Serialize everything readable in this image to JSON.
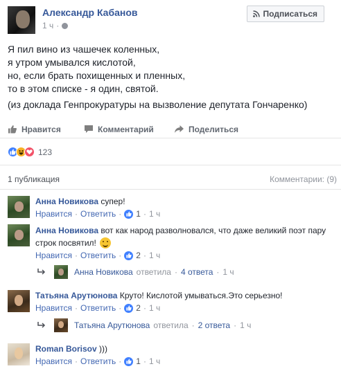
{
  "post": {
    "author": "Александр Кабанов",
    "time": "1 ч",
    "subscribe_label": "Подписаться",
    "lines": [
      "Я пил вино из чашечек коленных,",
      "я утром умывался кислотой,",
      "но, если брать похищенных и пленных,",
      "то в этом списке - я один, святой."
    ],
    "note": "(из доклада Генпрокуратуры на вызволение депутата Гончаренко)"
  },
  "actions": {
    "like": "Нравится",
    "comment": "Комментарий",
    "share": "Поделиться"
  },
  "reactions": {
    "count": "123",
    "types": [
      "like-icon",
      "haha-icon",
      "love-icon"
    ]
  },
  "summary": {
    "publications": "1 публикация",
    "comments": "Комментарии: (9)"
  },
  "comments": [
    {
      "author": "Анна Новикова",
      "text": "супер!",
      "like_label": "Нравится",
      "reply_label": "Ответить",
      "likes": "1",
      "time": "1 ч"
    },
    {
      "author": "Анна Новикова",
      "text": "вот как народ разволновался, что даже великий поэт пару строк посвятил!",
      "like_label": "Нравится",
      "reply_label": "Ответить",
      "likes": "2",
      "time": "1 ч",
      "reply": {
        "name": "Анна Новикова",
        "verb": "ответила",
        "count": "4 ответа",
        "time": "1 ч"
      }
    },
    {
      "author": "Татьяна Арутюнова",
      "text": "Круто! Кислотой умываться.Это серьезно!",
      "like_label": "Нравится",
      "reply_label": "Ответить",
      "likes": "2",
      "time": "1 ч",
      "reply": {
        "name": "Татьяна Арутюнова",
        "verb": "ответила",
        "count": "2 ответа",
        "time": "1 ч"
      }
    },
    {
      "author": "Roman Borisov",
      "text": ")))",
      "like_label": "Нравится",
      "reply_label": "Ответить",
      "likes": "1",
      "time": "1 ч"
    }
  ],
  "colors": {
    "link": "#365899",
    "muted": "#90949c",
    "like_blue": "#4080ff"
  }
}
